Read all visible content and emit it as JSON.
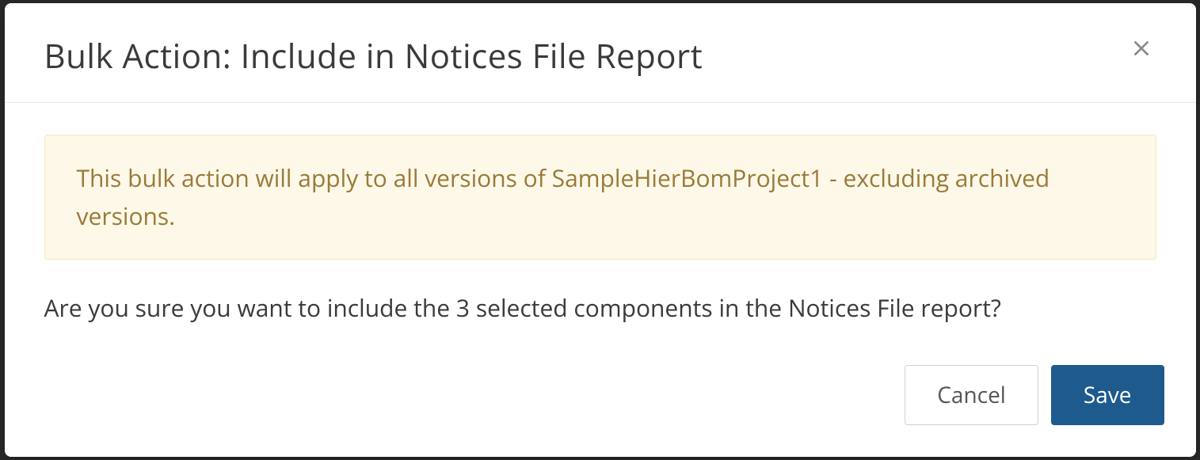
{
  "modal": {
    "title": "Bulk Action: Include in Notices File Report",
    "warning": "This bulk action will apply to all versions of SampleHierBomProject1 - excluding archived versions.",
    "confirm": "Are you sure you want to include the 3 selected components in the Notices File report?",
    "buttons": {
      "cancel": "Cancel",
      "save": "Save"
    }
  }
}
